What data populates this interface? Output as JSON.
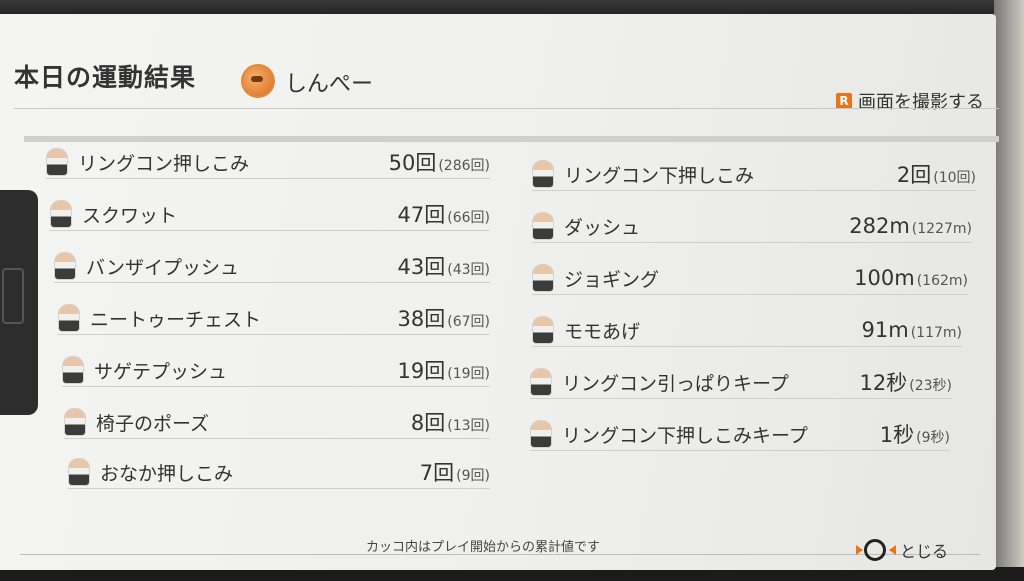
{
  "header": {
    "title": "本日の運動結果",
    "user_name": "しんぺー",
    "screenshot_key": "R",
    "screenshot_label": "画面を撮影する"
  },
  "exercises_left": [
    {
      "name": "リングコン押しこみ",
      "count": "50回",
      "total": "(286回)"
    },
    {
      "name": "スクワット",
      "count": "47回",
      "total": "(66回)"
    },
    {
      "name": "バンザイプッシュ",
      "count": "43回",
      "total": "(43回)"
    },
    {
      "name": "ニートゥーチェスト",
      "count": "38回",
      "total": "(67回)"
    },
    {
      "name": "サゲテプッシュ",
      "count": "19回",
      "total": "(19回)"
    },
    {
      "name": "椅子のポーズ",
      "count": "8回",
      "total": "(13回)"
    },
    {
      "name": "おなか押しこみ",
      "count": "7回",
      "total": "(9回)"
    }
  ],
  "exercises_right": [
    {
      "name": "リングコン下押しこみ",
      "count": "2回",
      "total": "(10回)"
    },
    {
      "name": "ダッシュ",
      "count": "282m",
      "total": "(1227m)"
    },
    {
      "name": "ジョギング",
      "count": "100m",
      "total": "(162m)"
    },
    {
      "name": "モモあげ",
      "count": "91m",
      "total": "(117m)"
    },
    {
      "name": "リングコン引っぱりキープ",
      "count": "12秒",
      "total": "(23秒)"
    },
    {
      "name": "リングコン下押しこみキープ",
      "count": "1秒",
      "total": "(9秒)"
    }
  ],
  "footer": {
    "note": "カッコ内はプレイ開始からの累計値です",
    "close_label": "とじる"
  },
  "colors": {
    "accent": "#e8741c",
    "screen_bg": "#f0f0ee",
    "text": "#333333"
  }
}
